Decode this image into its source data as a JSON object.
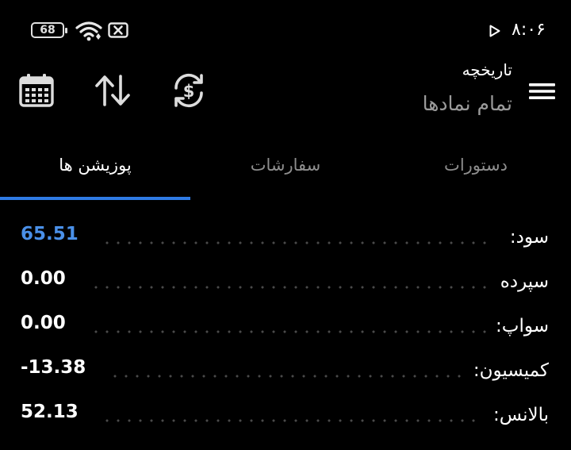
{
  "status_bar": {
    "battery_level": "68",
    "time": "۸:۰۶",
    "icons": [
      "battery-icon",
      "wifi-icon",
      "no-sim-icon",
      "play-store-icon"
    ]
  },
  "header": {
    "subtitle": "تاریخچه",
    "title": "تمام نمادها",
    "icons": [
      "calendar-icon",
      "sort-icon",
      "currency-exchange-icon",
      "menu-icon"
    ]
  },
  "tabs": [
    {
      "label": "دستورات",
      "active": false
    },
    {
      "label": "سفارشات",
      "active": false
    },
    {
      "label": "پوزیشن ها",
      "active": true
    }
  ],
  "summary": [
    {
      "label": "سود:",
      "value": "65.51",
      "accent": "#4a90e8"
    },
    {
      "label": "سپرده",
      "value": "0.00"
    },
    {
      "label": "سواپ:",
      "value": "0.00"
    },
    {
      "label": "کمیسیون:",
      "value": "-13.38"
    },
    {
      "label": "بالانس:",
      "value": "52.13"
    }
  ],
  "colors": {
    "background": "#000000",
    "accent": "#2f7be5",
    "inactive_text": "#8e8e8e"
  }
}
